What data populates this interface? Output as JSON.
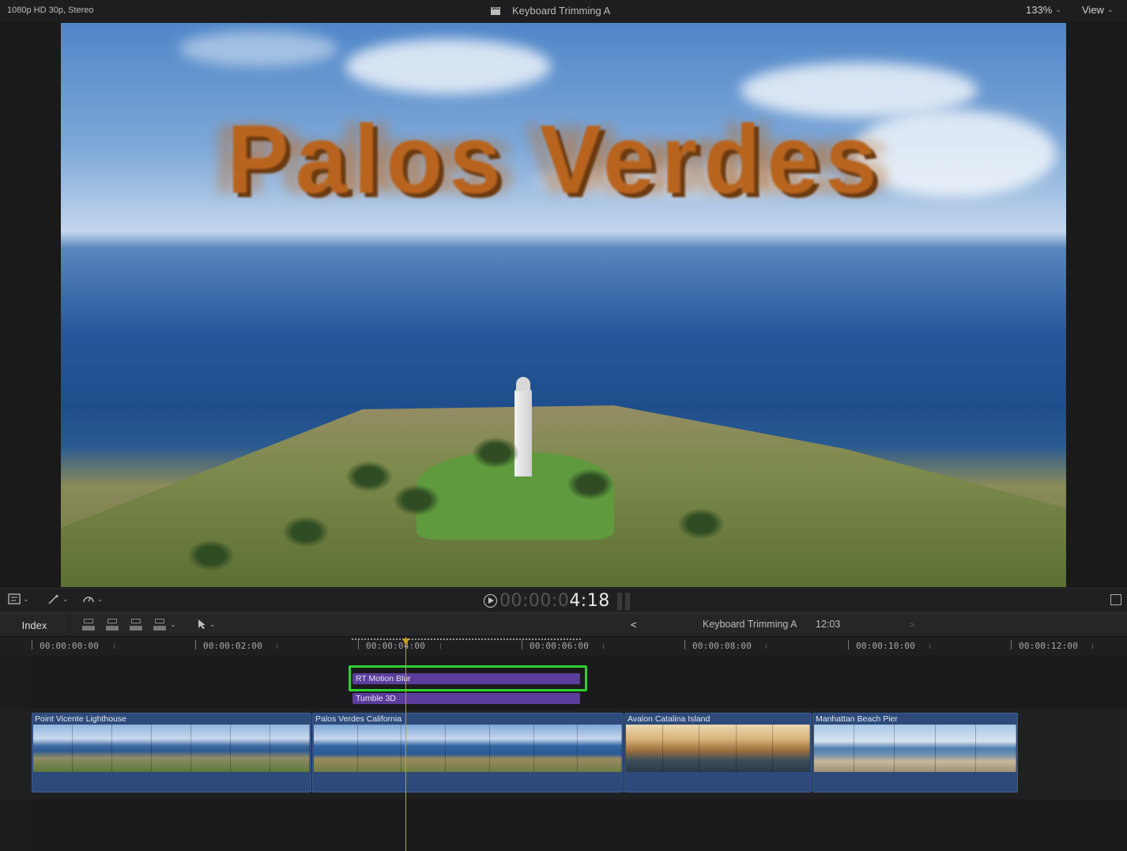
{
  "viewer": {
    "format": "1080p HD 30p, Stereo",
    "title": "Keyboard Trimming A",
    "zoom": "133%",
    "view_menu": "View",
    "overlay_text": "Palos Verdes"
  },
  "transport": {
    "timecode_dim": "00:00:0",
    "timecode_bright": "4:18"
  },
  "timeline_toolbar": {
    "index_label": "Index",
    "prev_symbol": "<",
    "next_symbol": ">",
    "sequence_name": "Keyboard Trimming A",
    "sequence_duration": "12:03"
  },
  "ruler": {
    "labels": [
      "00:00:00:00",
      "00:00:02:00",
      "00:00:04:00",
      "00:00:06:00",
      "00:00:08:00",
      "00:00:10:00",
      "00:00:12:00"
    ]
  },
  "titles": [
    {
      "name": "RT Motion Blur"
    },
    {
      "name": "Tumble 3D"
    }
  ],
  "clips": [
    {
      "name": "Point Vicente Lighthouse"
    },
    {
      "name": "Palos Verdes California"
    },
    {
      "name": "Avalon Catalina Island"
    },
    {
      "name": "Manhattan Beach Pier"
    }
  ],
  "colors": {
    "selection": "#2ed02e",
    "title_clip": "#5b3d9c",
    "video_clip": "#2d4a7a",
    "playhead": "#c79a28"
  }
}
